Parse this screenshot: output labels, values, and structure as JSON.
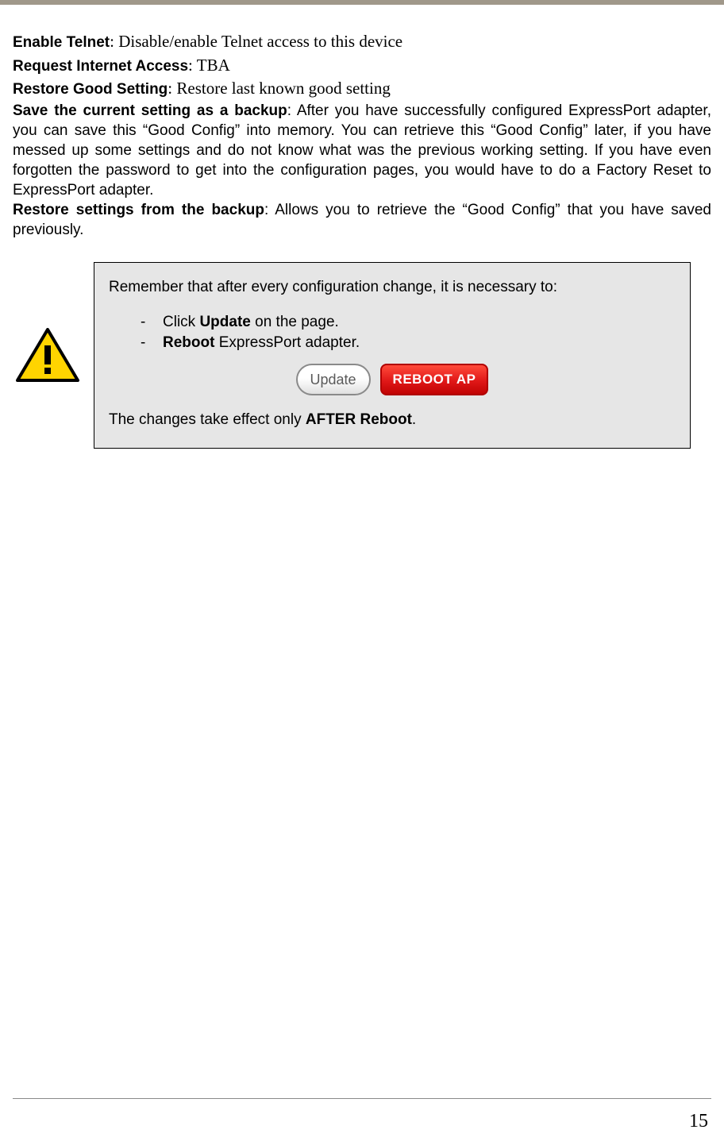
{
  "definitions": {
    "enable_telnet": {
      "term": "Enable Telnet",
      "desc": ": Disable/enable Telnet access to this device"
    },
    "request_internet": {
      "term": "Request Internet Access",
      "desc": ": TBA"
    },
    "restore_good": {
      "term": "Restore Good Setting",
      "desc": ": Restore last known good setting"
    },
    "save_backup": {
      "term": "Save the current setting as a backup",
      "desc": ": After you have successfully configured ExpressPort adapter, you can save this “Good Config” into memory. You can retrieve this “Good Config” later, if you have messed up some settings and do not know what was the previous working setting. If you have even forgotten the password to get into the configuration pages, you would have to do a Factory Reset to ExpressPort adapter."
    },
    "restore_backup": {
      "term": "Restore settings from the backup",
      "desc": ": Allows you to retrieve the “Good Config” that you have saved previously."
    }
  },
  "note": {
    "lead": "Remember that after every configuration change, it is necessary to:",
    "item1_prefix": "Click ",
    "item1_bold": "Update",
    "item1_suffix": " on the page.",
    "item2_bold": "Reboot",
    "item2_suffix": " ExpressPort adapter.",
    "update_btn": "Update",
    "reboot_btn": "REBOOT AP",
    "tail_prefix": "The changes take effect only ",
    "tail_bold": "AFTER Reboot",
    "tail_suffix": "."
  },
  "page_number": "15"
}
